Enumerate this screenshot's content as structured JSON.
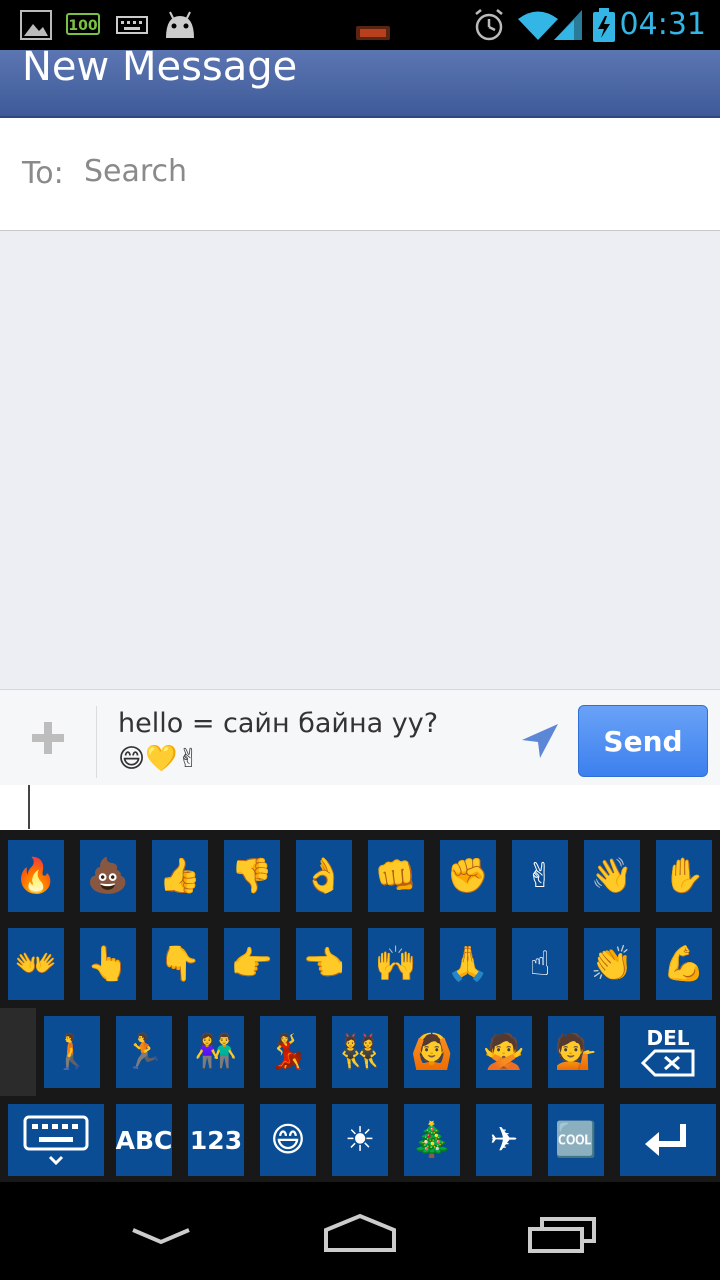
{
  "status_bar": {
    "battery_badge": "100",
    "time": "04:31",
    "icons": [
      "image-icon",
      "battery-100-icon",
      "keyboard-icon",
      "android-icon",
      "alarm-icon",
      "wifi-icon",
      "signal-icon",
      "battery-charging-icon"
    ]
  },
  "header": {
    "title": "New Message"
  },
  "recipient": {
    "label": "To:",
    "placeholder": "Search"
  },
  "composer": {
    "message_line1": "hello = сайн байна уу?",
    "message_line2": "😄💛✌",
    "send_label": "Send"
  },
  "keyboard": {
    "row1": [
      "🔥",
      "💩",
      "👍",
      "👎",
      "👌",
      "👊",
      "✊",
      "✌",
      "👋",
      "✋"
    ],
    "row2": [
      "👐",
      "👆",
      "👇",
      "👉",
      "👈",
      "🙌",
      "🙏",
      "☝",
      "👏",
      "💪"
    ],
    "row3": [
      "🚶",
      "🏃",
      "👫",
      "💃",
      "👯",
      "🙆",
      "🙅",
      "💁"
    ],
    "del_label": "DEL",
    "row4_emoji": [
      "😄",
      "☀",
      "🎄",
      "✈",
      "🆒"
    ],
    "abc_label": "ABC",
    "num_label": "123"
  },
  "colors": {
    "header": "#4a67a6",
    "key": "#0a4d94",
    "send": "#4a8df0",
    "clock": "#33b5e5"
  }
}
